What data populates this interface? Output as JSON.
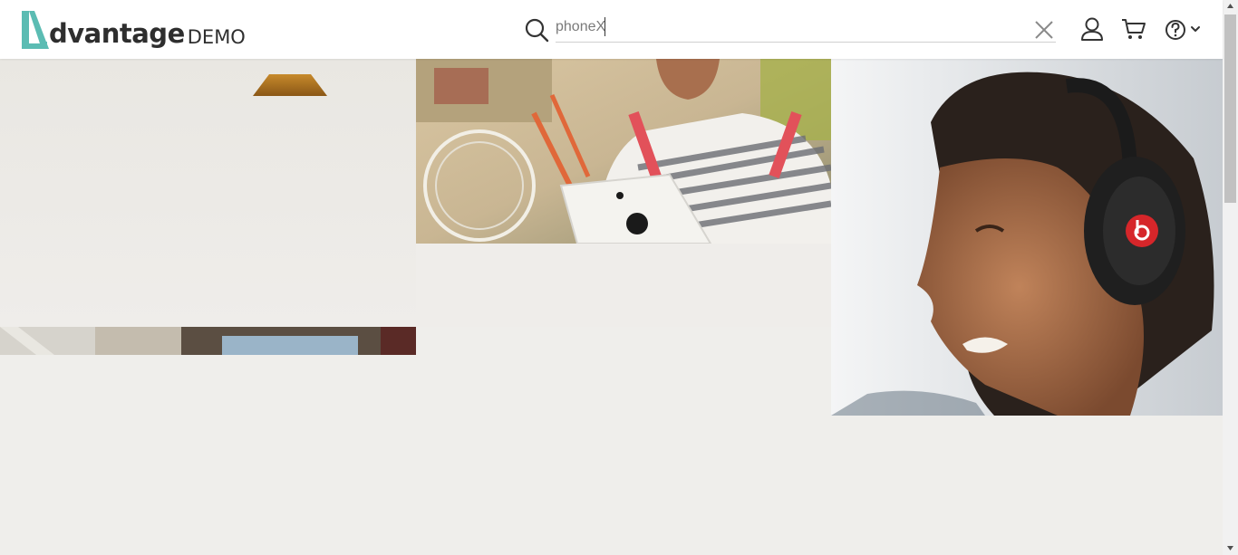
{
  "header": {
    "logo_word": "dvantage",
    "logo_suffix": "DEMO",
    "search": {
      "value": "phoneX",
      "placeholder": ""
    },
    "icons": {
      "search": "search-icon",
      "clear": "close-icon",
      "user": "user-icon",
      "cart": "cart-icon",
      "help": "help-icon"
    }
  },
  "colors": {
    "brand_teal": "#5bbcb3",
    "logo_text": "#2e2e2e",
    "page_background": "#efeeeb",
    "header_background": "#ffffff"
  }
}
